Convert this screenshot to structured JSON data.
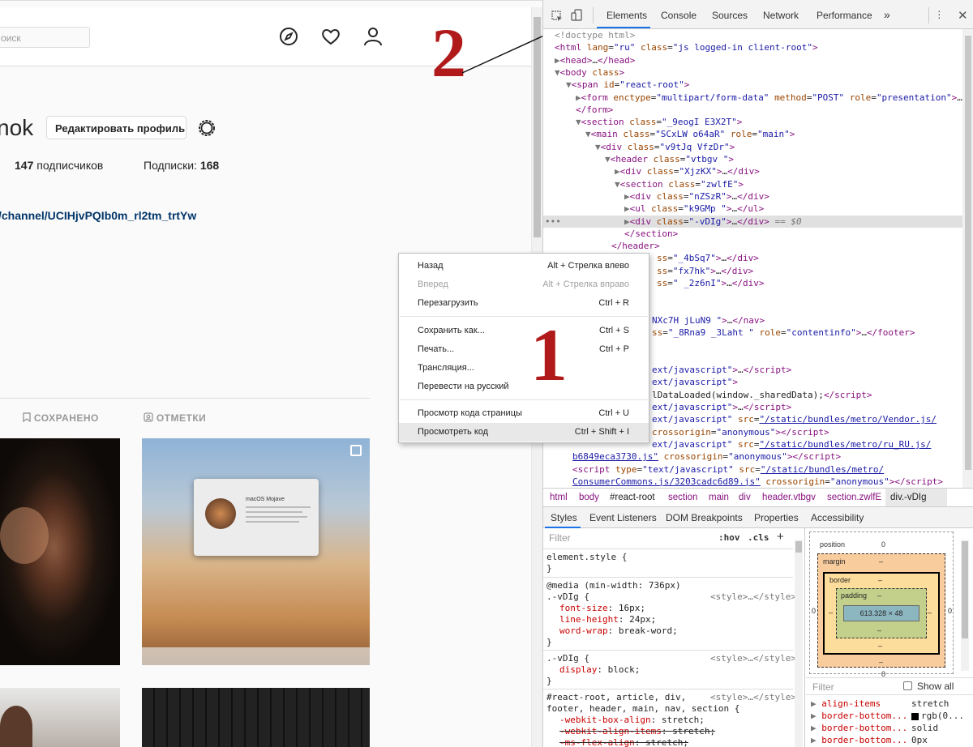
{
  "instagram": {
    "search_placeholder": "оиск",
    "name_fragment": "nok",
    "edit_profile_label": "Редактировать профиль",
    "followers_count": "147",
    "followers_label": "подписчиков",
    "following_label": "Подписки:",
    "following_count": "168",
    "bio_link": "/channel/UCIHjvPQIb0m_rl2tm_trtYw",
    "tab_saved": "СОХРАНЕНО",
    "tab_tagged": "ОТМЕТКИ",
    "mac_title": "macOS Mojave"
  },
  "annotations": {
    "one": "1",
    "two": "2"
  },
  "context_menu": {
    "items": [
      {
        "label": "Назад",
        "shortcut": "Alt + Стрелка влево",
        "disabled": false
      },
      {
        "label": "Вперед",
        "shortcut": "Alt + Стрелка вправо",
        "disabled": true
      },
      {
        "label": "Перезагрузить",
        "shortcut": "Ctrl + R",
        "disabled": false
      },
      {
        "label": "Сохранить как...",
        "shortcut": "Ctrl + S",
        "disabled": false
      },
      {
        "label": "Печать...",
        "shortcut": "Ctrl + P",
        "disabled": false
      },
      {
        "label": "Трансляция...",
        "shortcut": "",
        "disabled": false
      },
      {
        "label": "Перевести на русский",
        "shortcut": "",
        "disabled": false
      },
      {
        "label": "Просмотр кода страницы",
        "shortcut": "Ctrl + U",
        "disabled": false
      },
      {
        "label": "Просмотреть код",
        "shortcut": "Ctrl + Shift + I",
        "disabled": false
      }
    ]
  },
  "devtools": {
    "tabs": [
      "Elements",
      "Console",
      "Sources",
      "Network",
      "Performance"
    ],
    "more_tabs": "»",
    "active_tab": "Elements",
    "breadcrumbs": [
      "html",
      "body",
      "#react-root",
      "section",
      "main",
      "div",
      "header.vtbgv",
      "section.zwlfE",
      "div.-vDIg"
    ],
    "style_tabs": [
      "Styles",
      "Event Listeners",
      "DOM Breakpoints",
      "Properties",
      "Accessibility"
    ],
    "filter_placeholder": "Filter",
    "hov": ":hov",
    "cls": ".cls",
    "box_model": {
      "position": "position",
      "position_val": "0",
      "margin": "margin",
      "border": "border",
      "padding": "padding",
      "content": "613.328 × 48",
      "dash": "–",
      "zero": "0"
    },
    "computed_filter": "Filter",
    "show_all": "Show all",
    "selected_suffix": " == $0",
    "computed": [
      {
        "prop": "align-items",
        "val": "stretch"
      },
      {
        "prop": "border-bottom...",
        "val": "rgb(0..."
      },
      {
        "prop": "border-bottom...",
        "val": "solid"
      },
      {
        "prop": "border-bottom...",
        "val": "0px"
      }
    ]
  }
}
